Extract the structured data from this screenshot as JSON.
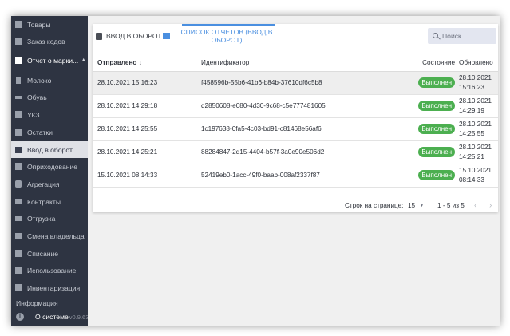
{
  "sidebar": {
    "items": [
      {
        "label": "Товары",
        "icon": "box-icon"
      },
      {
        "label": "Заказ кодов",
        "icon": "qr-code-icon"
      },
      {
        "label": "Отчет о марки...",
        "icon": "report-icon"
      },
      {
        "label": "Молоко",
        "icon": "milk-icon"
      },
      {
        "label": "Обувь",
        "icon": "shoe-icon"
      },
      {
        "label": "УКЗ",
        "icon": "ukz-icon"
      },
      {
        "label": "Остатки",
        "icon": "remains-icon"
      },
      {
        "label": "Ввод в оборот",
        "icon": "circulation-icon"
      },
      {
        "label": "Оприходование",
        "icon": "receipt-icon"
      },
      {
        "label": "Агрегация",
        "icon": "aggregation-icon"
      },
      {
        "label": "Контракты",
        "icon": "contracts-icon"
      },
      {
        "label": "Отгрузка",
        "icon": "truck-icon"
      },
      {
        "label": "Смена владельца",
        "icon": "owner-change-icon"
      },
      {
        "label": "Списание",
        "icon": "write-off-icon"
      },
      {
        "label": "Использование",
        "icon": "usage-icon"
      },
      {
        "label": "Инвентаризация",
        "icon": "inventory-icon"
      }
    ],
    "info_label": "Информация",
    "about_label": "О системе",
    "version": "v0.9.63"
  },
  "tabs": {
    "input_label": "Ввод в оборот",
    "list_label": "Список отчетов (ввод в оборот)"
  },
  "search": {
    "placeholder": "Поиск"
  },
  "table": {
    "headers": [
      "Отправлено",
      "Идентификатор",
      "Состояние",
      "Обновлено"
    ],
    "sort_arrow": "↓",
    "rows": [
      {
        "sent": "28.10.2021 15:16:23",
        "id": "f458596b-55b6-41b6-b84b-37610df6c5b8",
        "status": "Выполнен",
        "upd_date": "28.10.2021",
        "upd_time": "15:16:23"
      },
      {
        "sent": "28.10.2021 14:29:18",
        "id": "d2850608-e080-4d30-9c68-c5e777481605",
        "status": "Выполнен",
        "upd_date": "28.10.2021",
        "upd_time": "14:29:19"
      },
      {
        "sent": "28.10.2021 14:25:55",
        "id": "1c197638-0fa5-4c03-bd91-c81468e56af6",
        "status": "Выполнен",
        "upd_date": "28.10.2021",
        "upd_time": "14:25:55"
      },
      {
        "sent": "28.10.2021 14:25:21",
        "id": "88284847-2d15-4404-b57f-3a0e90e506d2",
        "status": "Выполнен",
        "upd_date": "28.10.2021",
        "upd_time": "14:25:21"
      },
      {
        "sent": "15.10.2021 08:14:33",
        "id": "52419eb0-1acc-49f0-baab-008af2337f87",
        "status": "Выполнен",
        "upd_date": "15.10.2021",
        "upd_time": "08:14:33"
      }
    ]
  },
  "pager": {
    "rows_per_page_label": "Строк на странице:",
    "rows_per_page": "15",
    "range": "1 - 5 из 5"
  },
  "colors": {
    "accent": "#4a8fe0",
    "sidebar_bg": "#2e3442",
    "success": "#4caf50"
  }
}
